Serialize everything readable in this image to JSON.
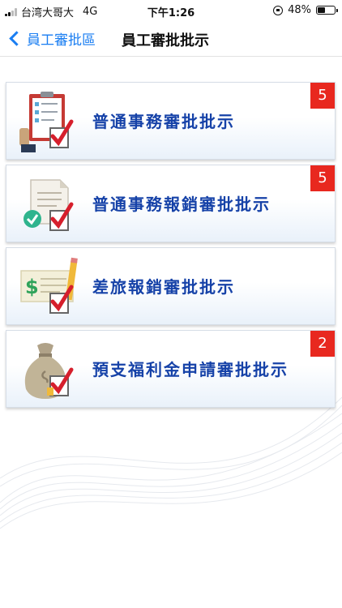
{
  "status_bar": {
    "carrier": "台湾大哥大",
    "network": "4G",
    "time": "下午1:26",
    "battery": "48%",
    "battery_level": 0.48
  },
  "nav": {
    "back_label": "員工審批區",
    "title": "員工審批批示"
  },
  "cards": [
    {
      "label": "普通事務審批批示",
      "badge": "5",
      "icon": "clipboard-checklist-icon"
    },
    {
      "label": "普通事務報銷審批批示",
      "badge": "5",
      "icon": "document-approved-icon"
    },
    {
      "label": "差旅報銷審批批示",
      "badge": "",
      "icon": "cheque-pencil-icon"
    },
    {
      "label": "預支福利金申請審批批示",
      "badge": "2",
      "icon": "money-bag-icon"
    }
  ],
  "colors": {
    "accent": "#1a7ef2",
    "label": "#1642a8",
    "badge": "#e8281f",
    "check": "#d61f2c"
  }
}
